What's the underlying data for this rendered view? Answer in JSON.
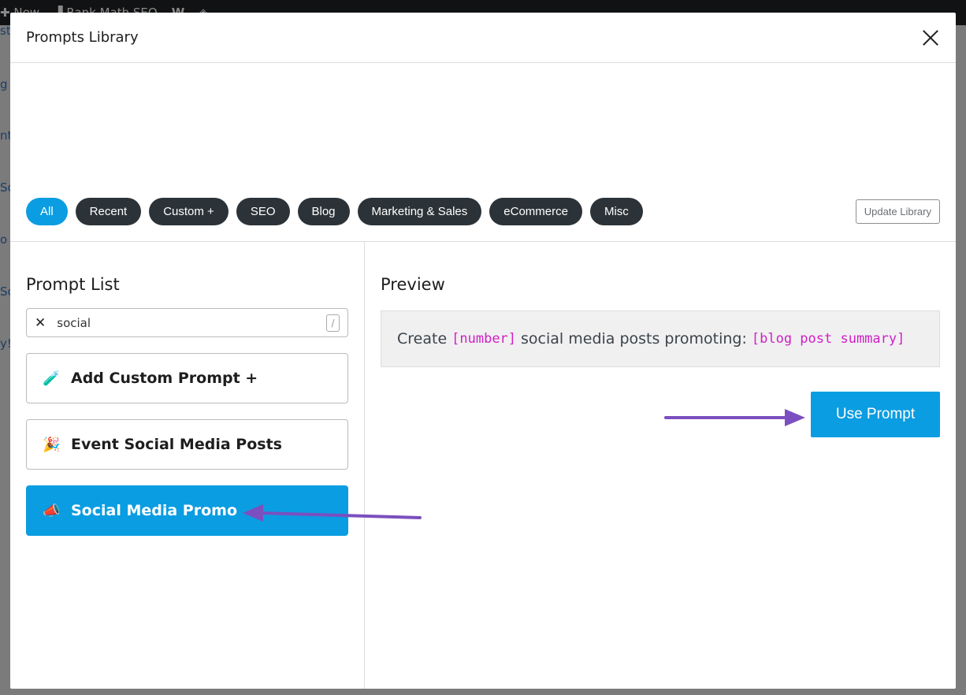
{
  "admin_bar": {
    "items": [
      "New",
      "Rank Math SEO"
    ]
  },
  "background_fragments": [
    "sto",
    "g a",
    "nt",
    "So",
    "o",
    "So",
    "y!"
  ],
  "modal": {
    "title": "Prompts Library",
    "categories": [
      {
        "label": "All",
        "active": true
      },
      {
        "label": "Recent"
      },
      {
        "label": "Custom +"
      },
      {
        "label": "SEO"
      },
      {
        "label": "Blog"
      },
      {
        "label": "Marketing & Sales"
      },
      {
        "label": "eCommerce"
      },
      {
        "label": "Misc"
      }
    ],
    "update_label": "Update Library",
    "prompt_list": {
      "heading": "Prompt List",
      "search_value": "social",
      "shortcut": "/",
      "items": [
        {
          "icon": "🧪",
          "label": "Add Custom Prompt +"
        },
        {
          "icon": "🎉",
          "label": "Event Social Media Posts"
        },
        {
          "icon": "📣",
          "label": "Social Media Promo",
          "active": true
        }
      ]
    },
    "preview": {
      "heading": "Preview",
      "parts": [
        "Create",
        "[number]",
        "social media posts promoting:",
        "[blog post summary]"
      ]
    },
    "use_label": "Use Prompt"
  },
  "colors": {
    "accent": "#0b9de1",
    "pill": "#2c3338",
    "tag": "#d01fc5",
    "annotation_arrow": "#7b4fbf"
  }
}
